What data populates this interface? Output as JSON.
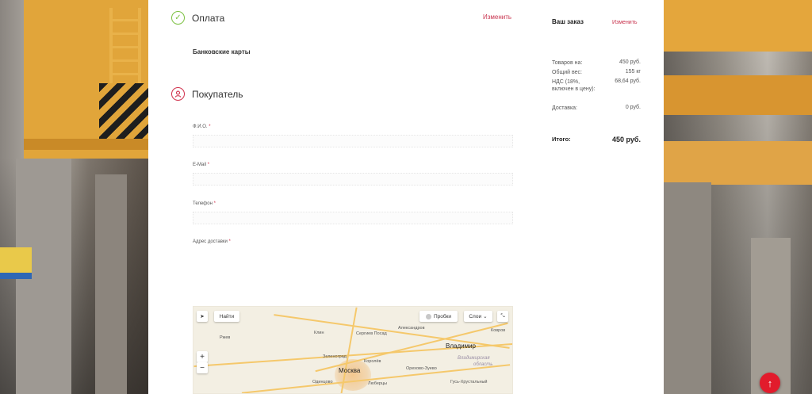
{
  "payment": {
    "title": "Оплата",
    "edit_label": "Изменить",
    "method": "Банковские карты"
  },
  "buyer": {
    "title": "Покупатель",
    "fields": {
      "name_label": "Ф.И.О.",
      "email_label": "E-Mail",
      "phone_label": "Телефон",
      "address_label": "Адрес доставки",
      "required_mark": "*"
    }
  },
  "map": {
    "find_label": "Найти",
    "traffic_label": "Пробки",
    "layers_label": "Слои",
    "zoom_in": "+",
    "zoom_out": "−",
    "labels": {
      "moscow": "Москва",
      "vladimir": "Владимир",
      "vladimir_region": "Владимирская",
      "vladimir_region2": "область",
      "klin": "Клин",
      "zelenograd": "Зеленоград",
      "korolev": "Королёв",
      "sergiev": "Сергиев Посад",
      "alexandrov": "Александров",
      "orekhovo": "Орехово-Зуево",
      "gus": "Гусь-Хрустальный",
      "kovrov": "Ковров",
      "rzhev": "Ржев",
      "lyubertsy": "Люберцы",
      "odintsovo": "Одинцово"
    }
  },
  "summary": {
    "title": "Ваш заказ",
    "edit_label": "Изменить",
    "goods_label": "Товаров на:",
    "goods_value": "450 руб.",
    "weight_label": "Общий вес:",
    "weight_value": "155 кг",
    "vat_label": "НДС (18%, включен в цену):",
    "vat_value": "68,64 руб.",
    "delivery_label": "Доставка:",
    "delivery_value": "0 руб.",
    "total_label": "Итого:",
    "total_value": "450 руб."
  },
  "scroll_top_icon": "arrow-up-icon",
  "colors": {
    "accent": "#c8334e",
    "check": "#7cc142",
    "scroll_button": "#e21b2c"
  }
}
